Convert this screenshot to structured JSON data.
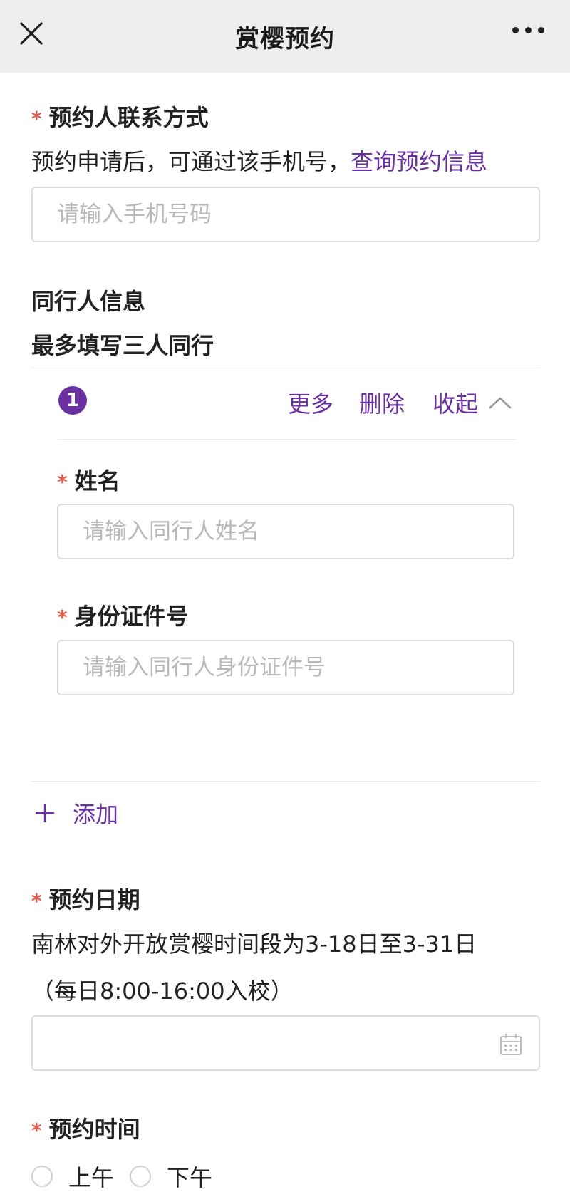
{
  "header": {
    "title": "赏樱预约"
  },
  "contact": {
    "label": "预约人联系方式",
    "desc_prefix": "预约申请后，可通过该手机号，",
    "desc_link": "查询预约信息",
    "placeholder": "请输入手机号码"
  },
  "companions": {
    "title": "同行人信息",
    "subtitle": "最多填写三人同行",
    "item": {
      "index": "1",
      "more_label": "更多",
      "delete_label": "删除",
      "collapse_label": "收起",
      "name_label": "姓名",
      "name_placeholder": "请输入同行人姓名",
      "id_label": "身份证件号",
      "id_placeholder": "请输入同行人身份证件号"
    },
    "add_label": "添加"
  },
  "date": {
    "label": "预约日期",
    "desc_line1": "南林对外开放赏樱时间段为3-18日至3-31日",
    "desc_line2": "（每日8:00-16:00入校）",
    "value": ""
  },
  "time": {
    "label": "预约时间",
    "options": [
      "上午",
      "下午"
    ]
  },
  "colors": {
    "accent": "#6a2fa0",
    "required": "#e25c4b",
    "topbar": "#ededed"
  },
  "icons": [
    "close-icon",
    "more-icon",
    "chevron-up-icon",
    "plus-icon",
    "calendar-icon"
  ]
}
